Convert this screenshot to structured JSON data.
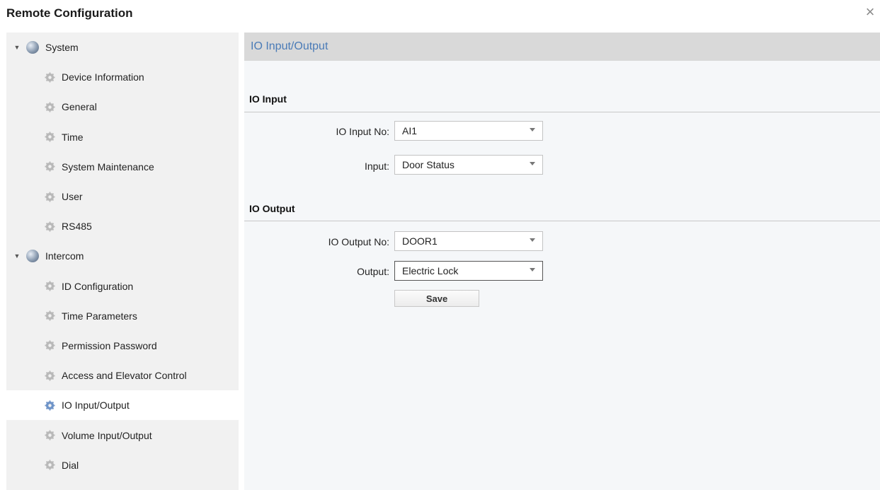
{
  "window": {
    "title": "Remote Configuration",
    "close_glyph": "×"
  },
  "sidebar": {
    "items": [
      {
        "label": "System",
        "type": "group",
        "icon": "globe-icon",
        "expanded": true
      },
      {
        "label": "Device Information",
        "type": "child",
        "icon": "gear-icon"
      },
      {
        "label": "General",
        "type": "child",
        "icon": "gear-icon"
      },
      {
        "label": "Time",
        "type": "child",
        "icon": "gear-icon"
      },
      {
        "label": "System Maintenance",
        "type": "child",
        "icon": "gear-icon"
      },
      {
        "label": "User",
        "type": "child",
        "icon": "gear-icon"
      },
      {
        "label": "RS485",
        "type": "child",
        "icon": "gear-icon"
      },
      {
        "label": "Intercom",
        "type": "group",
        "icon": "globe-icon",
        "expanded": true
      },
      {
        "label": "ID Configuration",
        "type": "child",
        "icon": "gear-icon"
      },
      {
        "label": "Time Parameters",
        "type": "child",
        "icon": "gear-icon"
      },
      {
        "label": "Permission Password",
        "type": "child",
        "icon": "gear-icon"
      },
      {
        "label": "Access and Elevator Control",
        "type": "child",
        "icon": "gear-icon"
      },
      {
        "label": "IO Input/Output",
        "type": "child",
        "icon": "gear-icon",
        "selected": true
      },
      {
        "label": "Volume Input/Output",
        "type": "child",
        "icon": "gear-icon"
      },
      {
        "label": "Dial",
        "type": "child",
        "icon": "gear-icon"
      }
    ]
  },
  "main": {
    "header": "IO Input/Output",
    "io_input": {
      "title": "IO Input",
      "input_no_label": "IO Input No:",
      "input_no_value": "AI1",
      "input_label": "Input:",
      "input_value": "Door Status"
    },
    "io_output": {
      "title": "IO Output",
      "output_no_label": "IO Output No:",
      "output_no_value": "DOOR1",
      "output_label": "Output:",
      "output_value": "Electric Lock"
    },
    "save_label": "Save"
  },
  "colors": {
    "header_text": "#4a7bb7",
    "header_bg": "#d9d9d9",
    "sidebar_bg": "#f1f1f1",
    "selected_bg": "#ffffff",
    "selected_icon": "#6f94c8"
  }
}
